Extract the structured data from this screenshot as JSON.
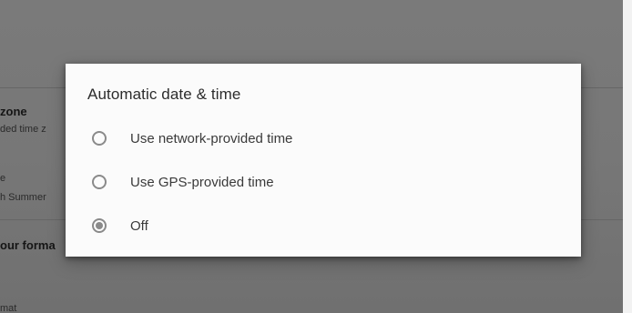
{
  "background": {
    "time_zone_title": "zone",
    "time_zone_subtitle": "ded time z",
    "item2_title": "e",
    "item2_subtitle": "h Summer",
    "format_title": "our forma",
    "format_label": "mat"
  },
  "dialog": {
    "title": "Automatic date & time",
    "options": [
      {
        "label": "Use network-provided time",
        "selected": false
      },
      {
        "label": "Use GPS-provided time",
        "selected": false
      },
      {
        "label": "Off",
        "selected": true
      }
    ]
  }
}
